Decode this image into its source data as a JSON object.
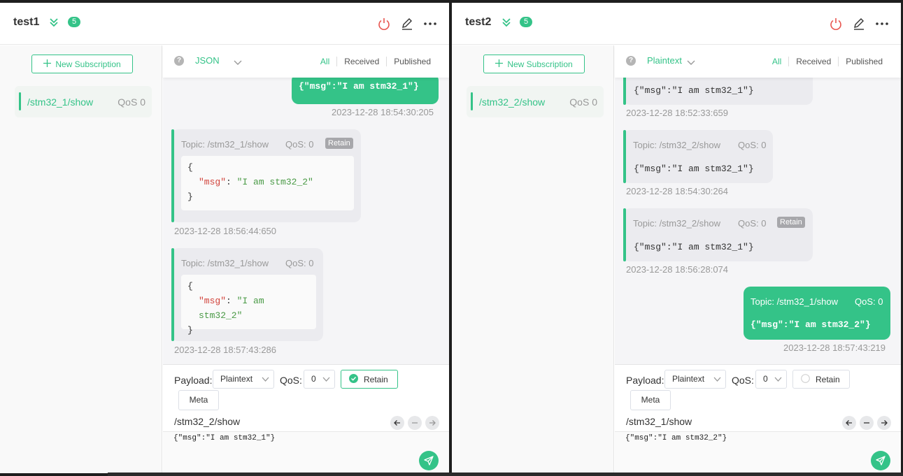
{
  "colors": {
    "accent": "#34c388",
    "danger": "#e8544e",
    "bubble_in": "#ebebef"
  },
  "windows": [
    {
      "header": {
        "name": "test1",
        "count": "5",
        "icons": [
          "chevron-double-down-icon",
          "power-icon",
          "edit-icon",
          "more-icon"
        ]
      },
      "sidebar": {
        "new_sub_label": "New Subscription",
        "subs": [
          {
            "topic": "/stm32_1/show",
            "qos": "QoS 0"
          }
        ]
      },
      "filter": {
        "format": "JSON",
        "tabs": [
          "All",
          "Received",
          "Published"
        ]
      },
      "messages": {
        "m0": {
          "text": "{\"msg\":\"I am stm32_1\"}",
          "time": "2023-12-28 18:54:30:205"
        },
        "m1": {
          "topic": "Topic: /stm32_1/show",
          "qos": "QoS: 0",
          "retain": "Retain",
          "json_open": "{",
          "json_key": "\"msg\"",
          "json_colon": ": ",
          "json_val": "\"I am stm32_2\"",
          "json_close": "}",
          "time": "2023-12-28 18:56:44:650"
        },
        "m2": {
          "topic": "Topic: /stm32_1/show",
          "qos": "QoS: 0",
          "json_open": "{",
          "json_key": "\"msg\"",
          "json_colon": ": ",
          "json_val": "\"I am stm32_2\"",
          "json_close": "}",
          "time": "2023-12-28 18:57:43:286"
        }
      },
      "compose": {
        "payload_label": "Payload:",
        "payload_format": "Plaintext",
        "qos_label": "QoS:",
        "qos_value": "0",
        "retain_label": "Retain",
        "retain_checked": true,
        "meta_label": "Meta",
        "topic": "/stm32_2/show",
        "payload": "{\"msg\":\"I am stm32_1\"}"
      }
    },
    {
      "header": {
        "name": "test2",
        "count": "5",
        "icons": [
          "chevron-double-down-icon",
          "power-icon",
          "edit-icon",
          "more-icon"
        ]
      },
      "sidebar": {
        "new_sub_label": "New Subscription",
        "subs": [
          {
            "topic": "/stm32_2/show",
            "qos": "QoS 0"
          }
        ]
      },
      "filter": {
        "format": "Plaintext",
        "tabs": [
          "All",
          "Received",
          "Published"
        ]
      },
      "messages": {
        "m0": {
          "text": "{\"msg\":\"I am stm32_1\"}",
          "time": "2023-12-28 18:52:33:659"
        },
        "m1": {
          "topic": "Topic: /stm32_2/show",
          "qos": "QoS: 0",
          "text": "{\"msg\":\"I am stm32_1\"}",
          "time": "2023-12-28 18:54:30:264"
        },
        "m2": {
          "topic": "Topic: /stm32_2/show",
          "qos": "QoS: 0",
          "retain": "Retain",
          "text": "{\"msg\":\"I am stm32_1\"}",
          "time": "2023-12-28 18:56:28:074"
        },
        "m3": {
          "topic": "Topic: /stm32_1/show",
          "qos": "QoS: 0",
          "text": "{\"msg\":\"I am stm32_2\"}",
          "time": "2023-12-28 18:57:43:219"
        }
      },
      "compose": {
        "payload_label": "Payload:",
        "payload_format": "Plaintext",
        "qos_label": "QoS:",
        "qos_value": "0",
        "retain_label": "Retain",
        "retain_checked": false,
        "meta_label": "Meta",
        "topic": "/stm32_1/show",
        "payload": "{\"msg\":\"I am stm32_2\"}"
      }
    }
  ]
}
